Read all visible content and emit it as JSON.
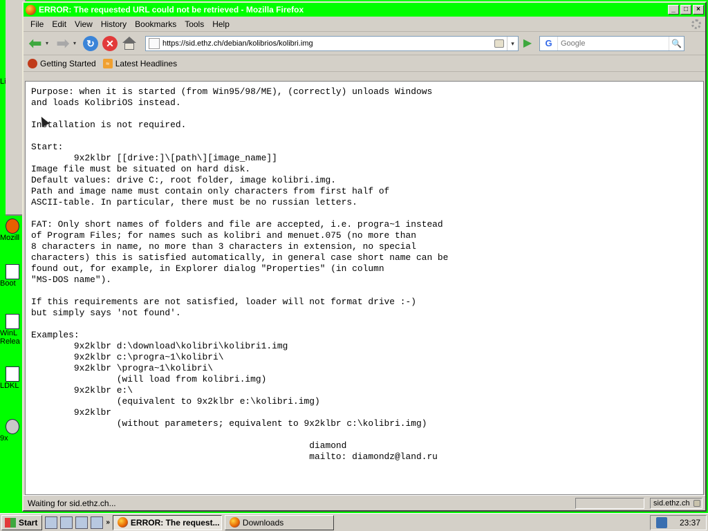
{
  "window": {
    "title": "ERROR: The requested URL could not be retrieved - Mozilla Firefox",
    "minimize_glyph": "_",
    "maximize_glyph": "□",
    "close_glyph": "×"
  },
  "menu": {
    "items": [
      "File",
      "Edit",
      "View",
      "History",
      "Bookmarks",
      "Tools",
      "Help"
    ]
  },
  "nav": {
    "back_glyph": "⬅",
    "forward_glyph": "➡",
    "dropdown_glyph": "▾",
    "reload_glyph": "↻",
    "stop_glyph": "✕",
    "url": "https://sid.ethz.ch/debian/kolibrios/kolibri.img",
    "go_glyph": "▶"
  },
  "search": {
    "engine_glyph": "G",
    "placeholder": "Google",
    "button_glyph": "🔍"
  },
  "bookmarks": {
    "items": [
      "Getting Started",
      "Latest Headlines"
    ],
    "rss_glyph": "≈"
  },
  "document": {
    "text": "Purpose: when it is started (from Win95/98/ME), (correctly) unloads Windows\nand loads KolibriOS instead.\n\nInstallation is not required.\n\nStart:\n        9x2klbr [[drive:]\\[path\\][image_name]]\nImage file must be situated on hard disk.\nDefault values: drive C:, root folder, image kolibri.img.\nPath and image name must contain only characters from first half of\nASCII-table. In particular, there must be no russian letters.\n\nFAT: Only short names of folders and file are accepted, i.e. progra~1 instead\nof Program Files; for names such as kolibri and menuet.075 (no more than\n8 characters in name, no more than 3 characters in extension, no special\ncharacters) this is satisfied automatically, in general case short name can be\nfound out, for example, in Explorer dialog \"Properties\" (in column\n\"MS-DOS name\").\n\nIf this requirements are not satisfied, loader will not format drive :-)\nbut simply says 'not found'.\n\nExamples:\n        9x2klbr d:\\download\\kolibri\\kolibri1.img\n        9x2klbr c:\\progra~1\\kolibri\\\n        9x2klbr \\progra~1\\kolibri\\\n                (will load from kolibri.img)\n        9x2klbr e:\\\n                (equivalent to 9x2klbr e:\\kolibri.img)\n        9x2klbr\n                (without parameters; equivalent to 9x2klbr c:\\kolibri.img)\n\n                                                    diamond\n                                                    mailto: diamondz@land.ru"
  },
  "status": {
    "text": "Waiting for sid.ethz.ch...",
    "host": "sid.ethz.ch"
  },
  "desktop": {
    "icons": [
      "Li",
      "Mozill",
      "Boot",
      "WinL\nRelea",
      "LDKL",
      "9x"
    ]
  },
  "taskbar": {
    "start_label": "Start",
    "chevron": "»",
    "tasks": [
      "ERROR: The request...",
      "Downloads"
    ],
    "clock": "23:37"
  },
  "colors": {
    "desktop": "#00ff00",
    "titlebar": "#00ff00",
    "chrome": "#d4d0c8"
  }
}
